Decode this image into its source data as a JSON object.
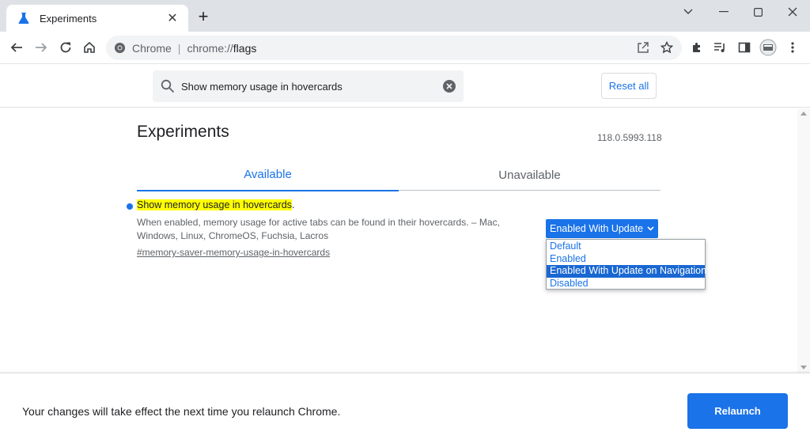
{
  "tab": {
    "title": "Experiments",
    "close": "✕",
    "new_tab": "+"
  },
  "omnibox": {
    "site_label": "Chrome",
    "separator": "|",
    "url_scheme": "chrome://",
    "url_host": "flags"
  },
  "search": {
    "value": "Show memory usage in hovercards",
    "reset_label": "Reset all"
  },
  "page": {
    "title": "Experiments",
    "version": "118.0.5993.118",
    "tabs": [
      "Available",
      "Unavailable"
    ]
  },
  "flag": {
    "name": "Show memory usage in hovercards",
    "name_suffix": ".",
    "description": "When enabled, memory usage for active tabs can be found in their hovercards. – Mac, Windows, Linux, ChromeOS, Fuchsia, Lacros",
    "link": "#memory-saver-memory-usage-in-hovercards",
    "selected_value": "Enabled With Update",
    "options": [
      "Default",
      "Enabled",
      "Enabled With Update on Navigation",
      "Disabled"
    ],
    "highlighted_option": "Enabled With Update on Navigation"
  },
  "footer": {
    "message": "Your changes will take effect the next time you relaunch Chrome.",
    "relaunch_label": "Relaunch"
  },
  "colors": {
    "accent": "#1a73e8",
    "highlight": "#ffff00",
    "tabstrip": "#dee1e6"
  }
}
